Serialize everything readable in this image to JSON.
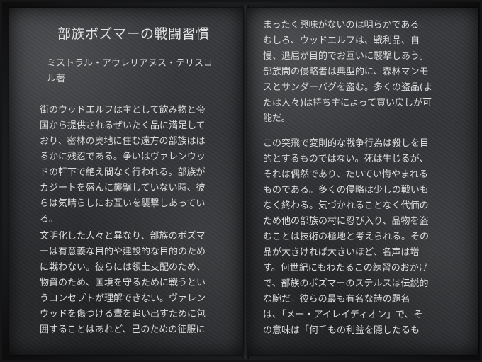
{
  "book": {
    "title": "部族ボズマーの戦闘習慣",
    "author_lines": [
      "ミストラル・アウレリアヌス・テリスコ",
      "ル著"
    ],
    "left_paragraphs": [
      {
        "lines": [
          "街のウッドエルフは主として飲み物と帝",
          "国から提供されるぜいたく品に満足して",
          "おり、密林の奥地に住む遠方の部族はは",
          "るかに残忍である。争いはヴァレンウッ",
          "ドの軒下で絶え間なく行われる。部族が",
          "カジートを盛んに襲撃していない時、彼",
          "らは気晴らしにお互いを襲撃しあってい",
          "る。"
        ]
      },
      {
        "lines": [
          "文明化した人々と異なり、部族のボズマ",
          "ーは有意義な目的や建設的な目的のため",
          "に戦わない。彼らには領土支配のため、",
          "物資のため、国境を守るために戦うとい",
          "うコンセプトが理解できない。ヴァレン",
          "ウッドを傷つける輩を追い出すために包",
          "囲することはあれど、己のための征服に"
        ]
      }
    ],
    "right_paragraphs": [
      {
        "lines": [
          "まったく興味がないのは明らかである。",
          "むしろ、ウッドエルフは、戦利品、自",
          "慢、退屈が目的でお互いに襲撃しあう。",
          "部族間の侵略者は典型的に、森林マンモ",
          "スとサンダーバグを盗む。多くの盗品(ま",
          "たは人々)は持ち主によって買い戻しが可",
          "能だ。"
        ]
      },
      {
        "lines": [
          "この突飛で変則的な戦争行為は殺しを目",
          "的とするものではない。死は生じるが、",
          "それは偶然であり、たいてい悔やまれる",
          "ものである。多くの侵略は少しの戦いも",
          "なく終わる。気づかれることなく代価の",
          "ため他の部族の村に忍び入り、品物を盗",
          "むことは技術の極地と考えられる。その",
          "品が大きければ大きいほど、名声は増",
          "す。何世紀にもわたるこの練習のおかげ",
          "で、部族のボズマーのステルスは伝説的",
          "な腕だ。彼らの最も有名な詩の題名",
          "は、「メー・アイレイディオン」で、そ",
          "の意味は「何千もの利益を隠したるも"
        ]
      }
    ]
  }
}
